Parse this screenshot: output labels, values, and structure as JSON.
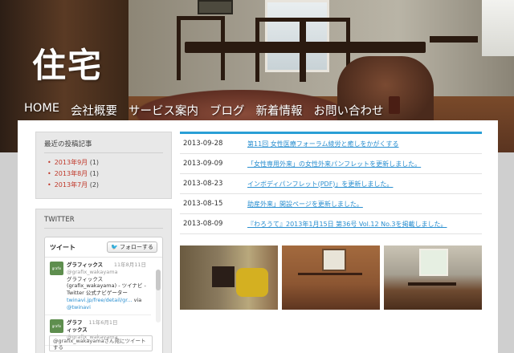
{
  "site": {
    "logo": "住宅"
  },
  "nav": [
    {
      "label": "HOME"
    },
    {
      "label": "会社概要"
    },
    {
      "label": "サービス案内"
    },
    {
      "label": "ブログ"
    },
    {
      "label": "新着情報"
    },
    {
      "label": "お問い合わせ"
    }
  ],
  "sidebar": {
    "recent_title": "最近の投稿記事",
    "archives": [
      {
        "label": "2013年9月",
        "count": "(1)"
      },
      {
        "label": "2013年8月",
        "count": "(1)"
      },
      {
        "label": "2013年7月",
        "count": "(2)"
      }
    ],
    "twitter": {
      "title": "TWITTER",
      "tweet_header": "ツイート",
      "follow_label": "フォローする",
      "tweets": [
        {
          "avatar": "grafix",
          "name": "グラフィックス",
          "date": "11年8月11日",
          "handle": "@grafix_wakayama",
          "text": "グラフィックス (grafix_wakayama) - ツイナビ - Twitter 公式ナビゲーター",
          "link": "twinavi.jp/free/detail/gr...",
          "via": "via",
          "via_handle": "@twinavi"
        },
        {
          "avatar": "grafix",
          "name": "グラフィックス",
          "date": "11年6月1日",
          "handle": "@grafix_wakayama"
        }
      ],
      "input_text": "@grafix_wakayamaさん宛にツイートする"
    }
  },
  "news": [
    {
      "date": "2013-09-28",
      "title": "第11回 女性医療フォーラム綾労と癒しをかがくする"
    },
    {
      "date": "2013-09-09",
      "title": "「女性専用外来」の女性外来パンフレットを更新しました。"
    },
    {
      "date": "2013-08-23",
      "title": "インボディパンフレット(PDF)」を更新しました。"
    },
    {
      "date": "2013-08-15",
      "title": "助産外来」開設ページを更新しました。"
    },
    {
      "date": "2013-08-09",
      "title": "『わろうて』2013年1月15日 第36号 Vol.12 No.3を掲載しました。"
    }
  ],
  "colors": {
    "accent": "#2a9fd6",
    "link": "#2a8fd0",
    "archive": "#c0392b"
  }
}
